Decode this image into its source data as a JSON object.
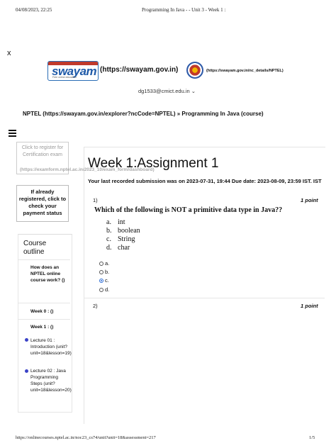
{
  "print_header": {
    "datetime": "04/08/2023, 22:25",
    "title": "Programming In Java - - Unit 3 - Week 1 :"
  },
  "close_label": "x",
  "swayam": {
    "logo_word": "swayam",
    "logo_tagline": "Free online education",
    "url_label": "(https://swayam.gov.in)"
  },
  "nptel": {
    "url_label": "(https://swayam.gov.in/nc_details/NPTEL)"
  },
  "user": {
    "email": "dg1533@cmict.edu.in ⌄"
  },
  "breadcrumb": {
    "text": "NPTEL (https://swayam.gov.in/explorer?ncCode=NPTEL)  »  Programming In Java (course)"
  },
  "register": {
    "label": "Click to register for Certification exam",
    "url": "(https://examform.nptel.ac.in/2023_10/exam_form/dashboard)"
  },
  "status": {
    "label": "If already registered, click to check your payment status"
  },
  "outline": {
    "title": "Course outline",
    "items": [
      {
        "label": "How does an NPTEL online course work? ()"
      },
      {
        "label": "Week 0 : ()"
      },
      {
        "label": "Week 1 : ()"
      }
    ],
    "lectures": [
      {
        "label": "Lecture 01 : Introduction (unit?unit=18&lesson=19)"
      },
      {
        "label": "Lecture 02 : Java Programming Steps (unit?unit=18&lesson=20)"
      }
    ]
  },
  "assignment": {
    "title": "Week 1:Assignment 1",
    "submission_text": "Your last recorded submission was on 2023-07-31, 19:44  Due date: 2023-08-09, 23:59 IST. IST",
    "questions": [
      {
        "number": "1)",
        "points": "1 point",
        "text": "Which of the following is NOT a primitive data type in Java??",
        "options": [
          {
            "letter": "a.",
            "text": "int"
          },
          {
            "letter": "b.",
            "text": "boolean"
          },
          {
            "letter": "c.",
            "text": "String"
          },
          {
            "letter": "d.",
            "text": "char"
          }
        ],
        "choices": [
          "a.",
          "b.",
          "c.",
          "d."
        ],
        "selected": "c."
      },
      {
        "number": "2)",
        "points": "1 point"
      }
    ]
  },
  "footer": {
    "url": "https://onlinecourses.nptel.ac.in/noc23_cs74/unit?unit=18&assessment=217",
    "page": "1/5"
  },
  "colors": {
    "radio_selected": "#2b6cd6",
    "lecture_dot": "#3b43c7",
    "swayam_blue": "#1f5aa8"
  }
}
